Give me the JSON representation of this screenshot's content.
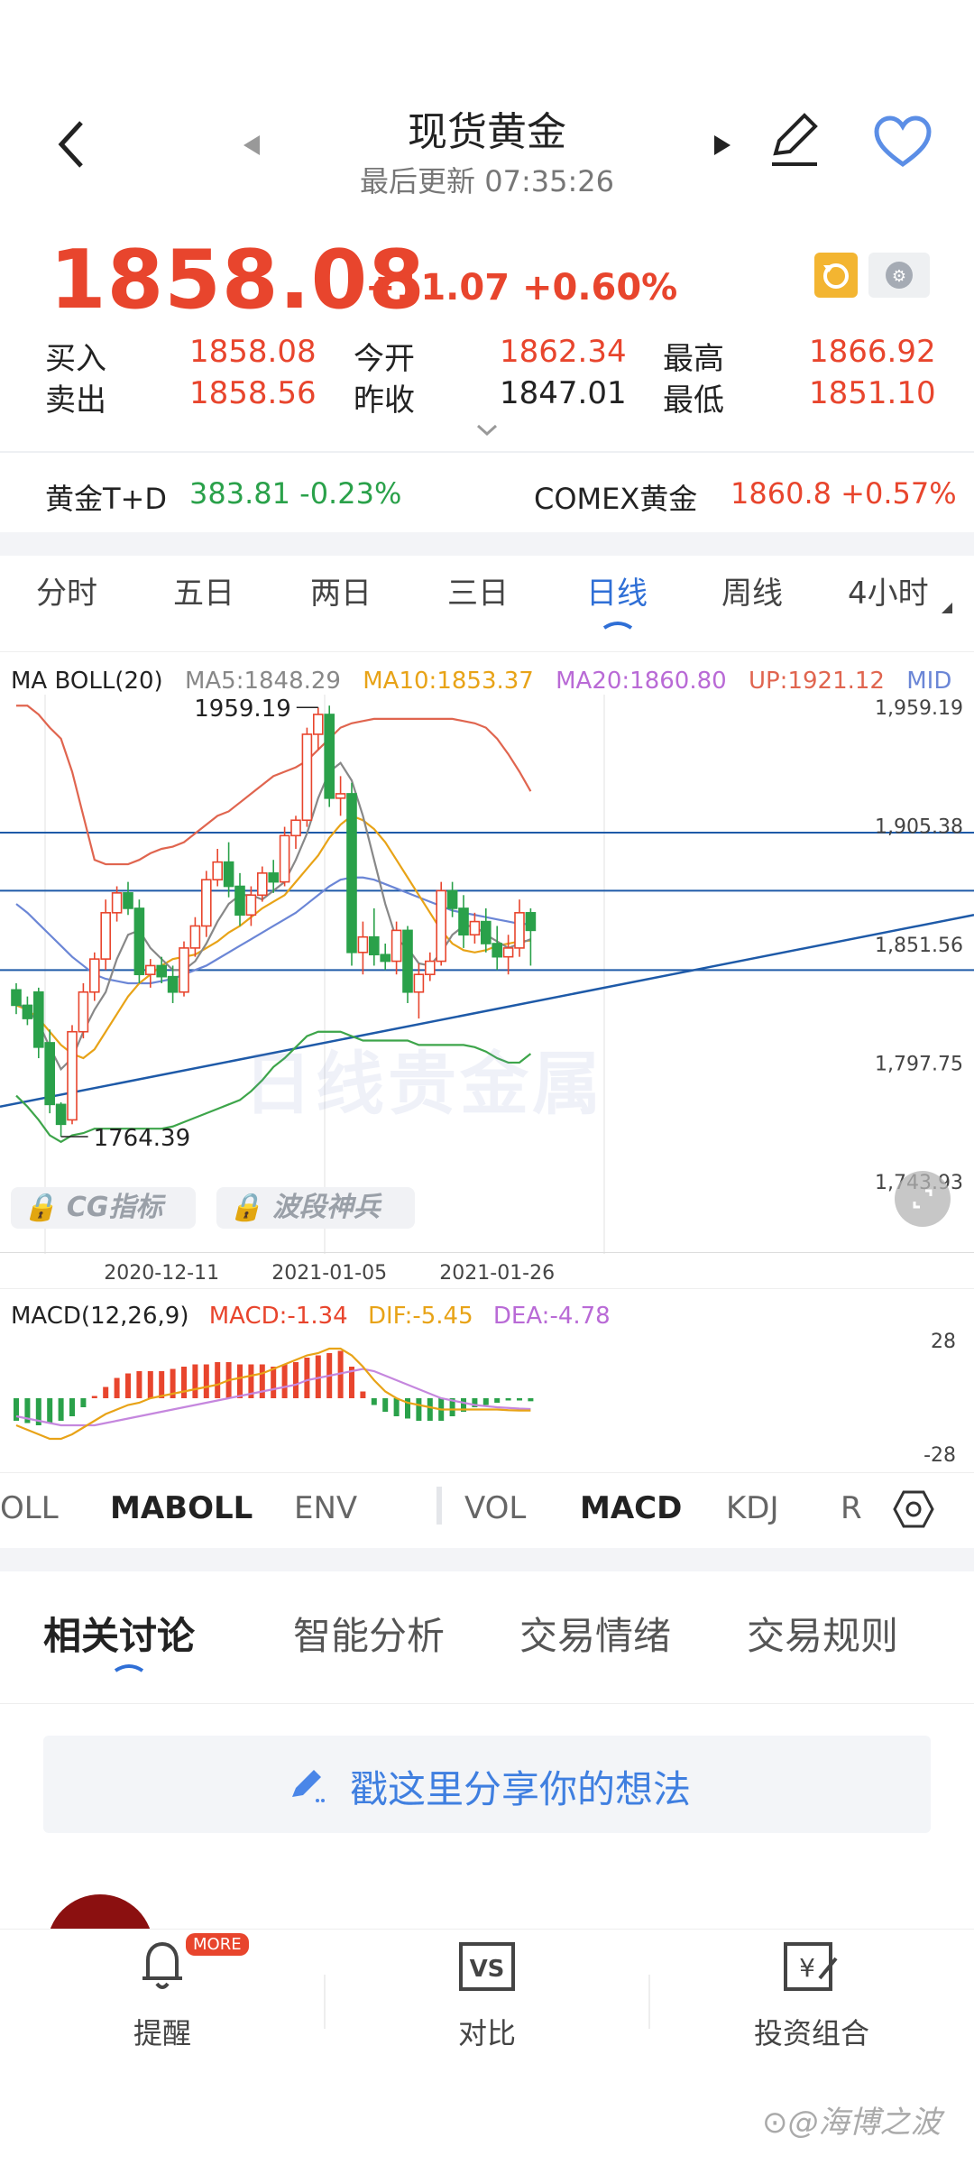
{
  "header": {
    "title": "现货黄金",
    "subtitle": "最后更新  07:35:26"
  },
  "quote": {
    "price": "1858.08",
    "change": "+11.07 +0.60%",
    "buy_label": "买入",
    "buy": "1858.08",
    "sell_label": "卖出",
    "sell": "1858.56",
    "open_label": "今开",
    "open": "1862.34",
    "prev_label": "昨收",
    "prev": "1847.01",
    "high_label": "最高",
    "high": "1866.92",
    "low_label": "最低",
    "low": "1851.10"
  },
  "related": [
    {
      "name": "黄金T+D",
      "value": "383.81 -0.23%"
    },
    {
      "name": "COMEX黄金",
      "value": "1860.8 +0.57%"
    }
  ],
  "periods": [
    "分时",
    "五日",
    "两日",
    "三日",
    "日线",
    "周线",
    "4小时"
  ],
  "active_period": "日线",
  "ma_legend": {
    "name": "MA BOLL(20)",
    "ma5": "MA5:1848.29",
    "ma10": "MA10:1853.37",
    "ma20": "MA20:1860.80",
    "up": "UP:1921.12",
    "mid": "MID"
  },
  "pills": [
    "CG指标",
    "波段神兵"
  ],
  "macd_legend": {
    "name": "MACD(12,26,9)",
    "macd": "MACD:-1.34",
    "dif": "DIF:-5.45",
    "dea": "DEA:-4.78"
  },
  "indicators": [
    "OLL",
    "MABOLL",
    "ENV",
    "VOL",
    "MACD",
    "KDJ",
    "R"
  ],
  "bottom_tabs": [
    "相关讨论",
    "智能分析",
    "交易情绪",
    "交易规则"
  ],
  "share_prompt": "戳这里分享你的想法",
  "nav": [
    {
      "label": "提醒",
      "badge": "MORE"
    },
    {
      "label": "对比"
    },
    {
      "label": "投资组合"
    }
  ],
  "watermark": "海博之波",
  "colors": {
    "up": "#e8452d",
    "down": "#2aa14a",
    "ma5": "#888888",
    "ma10": "#e8a317",
    "ma20": "#6b86d6",
    "boll_up": "#e0654f",
    "boll_dn": "#3da54a",
    "line": "#1e5aa8"
  },
  "chart_data": [
    {
      "type": "candlestick",
      "title": "",
      "y_ticks": [
        "1,959.19",
        "1,905.38",
        "1,851.56",
        "1,797.75",
        "1,743.93"
      ],
      "x_ticks": [
        "2020-12-11",
        "2021-01-05",
        "2021-01-26"
      ],
      "high_label": "1959.19",
      "low_label": "1764.39",
      "ylim": [
        1743.93,
        1965
      ],
      "candles": [
        [
          1831,
          1834,
          1820,
          1824
        ],
        [
          1824,
          1828,
          1815,
          1818
        ],
        [
          1830,
          1832,
          1800,
          1805
        ],
        [
          1807,
          1813,
          1775,
          1779
        ],
        [
          1779,
          1780,
          1764.39,
          1770
        ],
        [
          1772,
          1815,
          1770,
          1812
        ],
        [
          1812,
          1834,
          1809,
          1830
        ],
        [
          1830,
          1848,
          1826,
          1845
        ],
        [
          1845,
          1872,
          1840,
          1866
        ],
        [
          1866,
          1878,
          1862,
          1875
        ],
        [
          1875,
          1880,
          1865,
          1868
        ],
        [
          1868,
          1872,
          1834,
          1838
        ],
        [
          1838,
          1845,
          1832,
          1842
        ],
        [
          1842,
          1846,
          1834,
          1837
        ],
        [
          1837,
          1842,
          1825,
          1830
        ],
        [
          1830,
          1853,
          1828,
          1850
        ],
        [
          1850,
          1864,
          1846,
          1860
        ],
        [
          1860,
          1885,
          1855,
          1881
        ],
        [
          1881,
          1895,
          1878,
          1889
        ],
        [
          1889,
          1898,
          1873,
          1878
        ],
        [
          1878,
          1884,
          1860,
          1865
        ],
        [
          1865,
          1878,
          1860,
          1874
        ],
        [
          1874,
          1887,
          1871,
          1884
        ],
        [
          1884,
          1890,
          1875,
          1880
        ],
        [
          1880,
          1905,
          1878,
          1901
        ],
        [
          1901,
          1910,
          1895,
          1908
        ],
        [
          1908,
          1950,
          1905,
          1947
        ],
        [
          1947,
          1959.19,
          1940,
          1956
        ],
        [
          1956,
          1960,
          1914,
          1918
        ],
        [
          1918,
          1928,
          1910,
          1920
        ],
        [
          1920,
          1925,
          1842,
          1848
        ],
        [
          1848,
          1862,
          1838,
          1855
        ],
        [
          1855,
          1868,
          1842,
          1847
        ],
        [
          1847,
          1852,
          1840,
          1844
        ],
        [
          1844,
          1862,
          1838,
          1858
        ],
        [
          1858,
          1860,
          1825,
          1830
        ],
        [
          1830,
          1843,
          1818,
          1838
        ],
        [
          1838,
          1848,
          1835,
          1844
        ],
        [
          1844,
          1880,
          1842,
          1876
        ],
        [
          1876,
          1880,
          1864,
          1868
        ],
        [
          1868,
          1874,
          1850,
          1856
        ],
        [
          1856,
          1866,
          1852,
          1862
        ],
        [
          1862,
          1868,
          1848,
          1852
        ],
        [
          1852,
          1860,
          1840,
          1846
        ],
        [
          1846,
          1856,
          1838,
          1850
        ],
        [
          1850,
          1872,
          1846,
          1866
        ],
        [
          1866,
          1868,
          1842,
          1858
        ]
      ],
      "ma5": [
        1825,
        1822,
        1816,
        1805,
        1795,
        1800,
        1812,
        1822,
        1830,
        1845,
        1856,
        1858,
        1850,
        1845,
        1840,
        1840,
        1844,
        1852,
        1862,
        1870,
        1874,
        1874,
        1872,
        1876,
        1880,
        1890,
        1902,
        1918,
        1930,
        1934,
        1926,
        1910,
        1890,
        1870,
        1854,
        1850,
        1843,
        1842,
        1848,
        1856,
        1860,
        1860,
        1856,
        1853,
        1850,
        1852,
        1854
      ],
      "ma10": [
        1824,
        1822,
        1818,
        1812,
        1806,
        1802,
        1800,
        1804,
        1812,
        1820,
        1828,
        1834,
        1838,
        1842,
        1845,
        1846,
        1847,
        1850,
        1853,
        1857,
        1860,
        1864,
        1868,
        1871,
        1874,
        1880,
        1886,
        1892,
        1900,
        1906,
        1910,
        1908,
        1904,
        1898,
        1890,
        1882,
        1874,
        1866,
        1858,
        1852,
        1849,
        1848,
        1849,
        1851,
        1852,
        1853,
        1853.37
      ],
      "ma20": [
        1870,
        1866,
        1861,
        1856,
        1851,
        1846,
        1842,
        1838,
        1836,
        1835,
        1834,
        1834,
        1834,
        1835,
        1836,
        1838,
        1840,
        1842,
        1845,
        1848,
        1851,
        1854,
        1857,
        1860,
        1863,
        1866,
        1870,
        1874,
        1878,
        1881,
        1882,
        1882,
        1881,
        1879,
        1877,
        1875,
        1873,
        1871,
        1869,
        1867,
        1866,
        1865,
        1864,
        1863,
        1862,
        1861,
        1860.8
      ],
      "boll_up": [
        1960,
        1960,
        1956,
        1950,
        1945,
        1930,
        1910,
        1890,
        1888,
        1888,
        1888,
        1890,
        1893,
        1895,
        1896,
        1898,
        1902,
        1906,
        1910,
        1912,
        1916,
        1920,
        1924,
        1928,
        1930,
        1932,
        1935,
        1940,
        1945,
        1950,
        1952,
        1953,
        1954,
        1954,
        1954,
        1954,
        1954,
        1954,
        1954,
        1954,
        1953,
        1952,
        1950,
        1945,
        1938,
        1930,
        1921.12
      ],
      "boll_dn": [
        1783,
        1778,
        1772,
        1765,
        1762,
        1765,
        1766,
        1768,
        1768,
        1768,
        1768,
        1768,
        1768,
        1768,
        1769,
        1771,
        1773,
        1775,
        1777,
        1779,
        1781,
        1785,
        1790,
        1796,
        1800,
        1805,
        1810,
        1812,
        1812,
        1812,
        1810,
        1808,
        1808,
        1808,
        1808,
        1808,
        1806,
        1806,
        1806,
        1806,
        1806,
        1805,
        1803,
        1800,
        1798,
        1798,
        1802
      ]
    },
    {
      "type": "bar",
      "title": "",
      "y_ticks": [
        "28",
        "-28"
      ],
      "ylim": [
        -28,
        28
      ],
      "values": [
        -10,
        -11,
        -12,
        -11,
        -10,
        -8,
        -4,
        1,
        5,
        9,
        11,
        12,
        12,
        12,
        13,
        14,
        15,
        15,
        16,
        16,
        15,
        15,
        15,
        14,
        15,
        16,
        18,
        19,
        20,
        21,
        14,
        3,
        -3,
        -6,
        -8,
        -9,
        -10,
        -10,
        -10,
        -8,
        -6,
        -4,
        -3,
        -2,
        -1,
        -1,
        -1.34
      ],
      "dif": [
        -12,
        -14,
        -16,
        -18,
        -18,
        -16,
        -13,
        -10,
        -7,
        -5,
        -3,
        -2,
        0,
        1,
        2,
        3,
        4,
        5,
        6,
        8,
        9,
        10,
        11,
        13,
        15,
        17,
        19,
        20,
        22,
        22,
        19,
        14,
        8,
        3,
        0,
        -2,
        -3,
        -4,
        -5,
        -5,
        -5,
        -5,
        -5,
        -5,
        -5.3,
        -5.45,
        -5.45
      ],
      "dea": [
        -8,
        -9,
        -10,
        -11,
        -12,
        -12,
        -12,
        -12,
        -11,
        -10,
        -9,
        -8,
        -7,
        -6,
        -5,
        -4,
        -3,
        -2,
        -1,
        0,
        1,
        2,
        3,
        4,
        5,
        6,
        8,
        9,
        10,
        11,
        12,
        13,
        12,
        10,
        8,
        6,
        4,
        2,
        0,
        -1,
        -2,
        -3,
        -3.5,
        -4,
        -4.3,
        -4.6,
        -4.78
      ]
    }
  ]
}
